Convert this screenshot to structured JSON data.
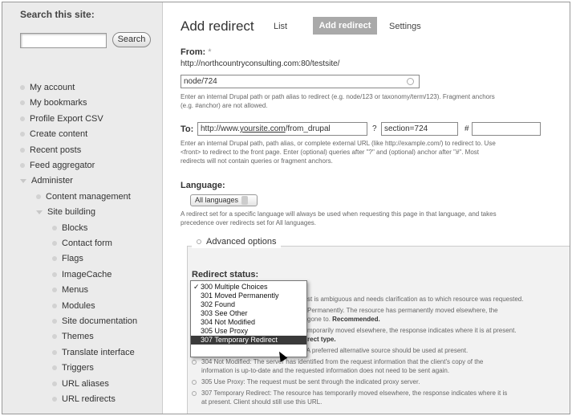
{
  "sidebar": {
    "search_title": "Search this site:",
    "search_button": "Search",
    "items": [
      {
        "label": "My account",
        "marker": "bullet"
      },
      {
        "label": "My bookmarks",
        "marker": "bullet"
      },
      {
        "label": "Profile Export CSV",
        "marker": "bullet"
      },
      {
        "label": "Create content",
        "marker": "bullet"
      },
      {
        "label": "Recent posts",
        "marker": "bullet"
      },
      {
        "label": "Feed aggregator",
        "marker": "bullet"
      },
      {
        "label": "Administer",
        "marker": "triangle"
      },
      {
        "label": "Content management",
        "marker": "bullet"
      },
      {
        "label": "Site building",
        "marker": "triangle"
      },
      {
        "label": "Blocks",
        "marker": "bullet"
      },
      {
        "label": "Contact form",
        "marker": "bullet"
      },
      {
        "label": "Flags",
        "marker": "bullet"
      },
      {
        "label": "ImageCache",
        "marker": "bullet"
      },
      {
        "label": "Menus",
        "marker": "bullet"
      },
      {
        "label": "Modules",
        "marker": "bullet"
      },
      {
        "label": "Site documentation",
        "marker": "bullet"
      },
      {
        "label": "Themes",
        "marker": "bullet"
      },
      {
        "label": "Translate interface",
        "marker": "bullet"
      },
      {
        "label": "Triggers",
        "marker": "bullet"
      },
      {
        "label": "URL aliases",
        "marker": "bullet"
      },
      {
        "label": "URL redirects",
        "marker": "bullet"
      }
    ]
  },
  "main": {
    "title": "Add redirect",
    "tabs": {
      "list": "List",
      "add": "Add redirect",
      "settings": "Settings"
    },
    "from": {
      "label": "From:",
      "required": "*",
      "base_url": "http://northcountryconsulting.com:80/testsite/",
      "value": "node/724",
      "description_1": "Enter an internal Drupal path or path alias to redirect (e.g. node/123 or taxonomy/term/123). Fragment anchors",
      "description_2": "(e.g. #anchor) are not allowed."
    },
    "to": {
      "label": "To:",
      "url_prefix": "http://www.",
      "url_link": "yoursite.com",
      "url_suffix": "/from_drupal",
      "query_sep": "?",
      "query_value": "section=724",
      "anchor_sep": "#",
      "anchor_value": "",
      "description_1": "Enter an internal Drupal path, path alias, or complete external URL (like http://example.com/) to redirect to. Use",
      "description_2": "<front> to redirect to the front page. Enter (optional) queries after \"?\" and (optional) anchor after \"#\". Most",
      "description_3": "redirects will not contain queries or fragment anchors."
    },
    "language": {
      "label": "Language:",
      "selected": "All languages",
      "description_1": "A redirect set for a specific language will always be used when requesting this page in that language, and takes",
      "description_2": "precedence over redirects set for All languages."
    },
    "advanced": {
      "legend": "Advanced options",
      "status_label": "Redirect status:",
      "lines": [
        {
          "pre": "",
          "bold": "",
          "post": "st is ambiguous and needs clarification as to which resource was requested."
        },
        {
          "pre": "Permanently. The resource has permanently moved elsewhere, the",
          "bold": "",
          "post": ""
        },
        {
          "pre": "gone to. ",
          "bold": "Recommended.",
          "post": ""
        },
        {
          "pre": "mporarily moved elsewhere, the response indicates where it is at present.",
          "bold": "",
          "post": ""
        },
        {
          "pre": "",
          "bold": "rect type.",
          "post": ""
        },
        {
          "pre": "303 See Other: See Other. Redirect. A preferred alternative source should be used at present.",
          "bold": "",
          "post": ""
        },
        {
          "pre": "304 Not Modified: The server has identified from the request information that the client's copy of the",
          "bold": "",
          "post": ""
        },
        {
          "pre": "information is up-to-date and the requested information does not need to be sent again.",
          "bold": "",
          "post": ""
        },
        {
          "pre": "305 Use Proxy: The request must be sent through the indicated proxy server.",
          "bold": "",
          "post": ""
        },
        {
          "pre": "307 Temporary Redirect: The resource has temporarily moved elsewhere, the response indicates where it is",
          "bold": "",
          "post": ""
        },
        {
          "pre": "at present. Client should still use this URL.",
          "bold": "",
          "post": ""
        }
      ],
      "dropdown": {
        "options": [
          "300 Multiple Choices",
          "301 Moved Permanently",
          "302 Found",
          "303 See Other",
          "304 Not Modified",
          "305 Use Proxy",
          "307 Temporary Redirect"
        ],
        "checked_index": 0,
        "highlighted_index": 6,
        "check_mark": "✓"
      }
    }
  }
}
